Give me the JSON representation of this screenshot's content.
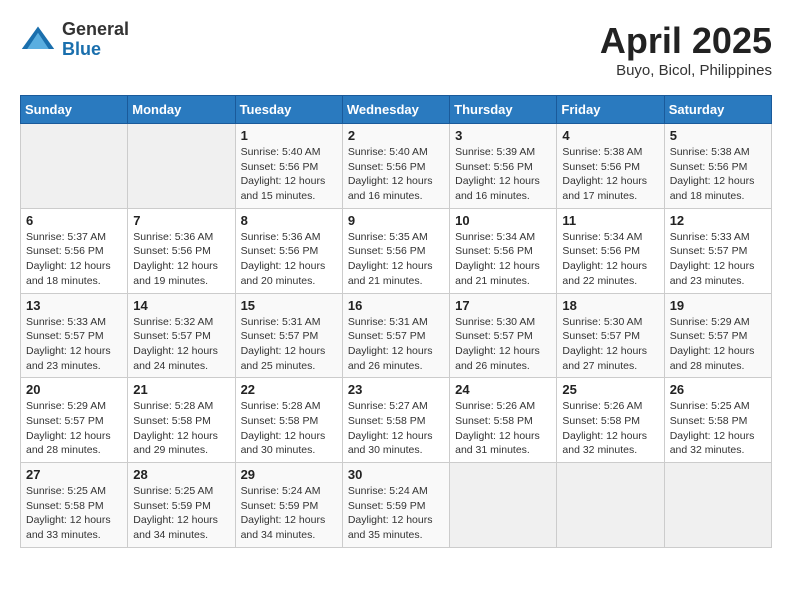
{
  "header": {
    "logo_general": "General",
    "logo_blue": "Blue",
    "title": "April 2025",
    "location": "Buyo, Bicol, Philippines"
  },
  "weekdays": [
    "Sunday",
    "Monday",
    "Tuesday",
    "Wednesday",
    "Thursday",
    "Friday",
    "Saturday"
  ],
  "weeks": [
    [
      {
        "day": "",
        "detail": ""
      },
      {
        "day": "",
        "detail": ""
      },
      {
        "day": "1",
        "detail": "Sunrise: 5:40 AM\nSunset: 5:56 PM\nDaylight: 12 hours and 15 minutes."
      },
      {
        "day": "2",
        "detail": "Sunrise: 5:40 AM\nSunset: 5:56 PM\nDaylight: 12 hours and 16 minutes."
      },
      {
        "day": "3",
        "detail": "Sunrise: 5:39 AM\nSunset: 5:56 PM\nDaylight: 12 hours and 16 minutes."
      },
      {
        "day": "4",
        "detail": "Sunrise: 5:38 AM\nSunset: 5:56 PM\nDaylight: 12 hours and 17 minutes."
      },
      {
        "day": "5",
        "detail": "Sunrise: 5:38 AM\nSunset: 5:56 PM\nDaylight: 12 hours and 18 minutes."
      }
    ],
    [
      {
        "day": "6",
        "detail": "Sunrise: 5:37 AM\nSunset: 5:56 PM\nDaylight: 12 hours and 18 minutes."
      },
      {
        "day": "7",
        "detail": "Sunrise: 5:36 AM\nSunset: 5:56 PM\nDaylight: 12 hours and 19 minutes."
      },
      {
        "day": "8",
        "detail": "Sunrise: 5:36 AM\nSunset: 5:56 PM\nDaylight: 12 hours and 20 minutes."
      },
      {
        "day": "9",
        "detail": "Sunrise: 5:35 AM\nSunset: 5:56 PM\nDaylight: 12 hours and 21 minutes."
      },
      {
        "day": "10",
        "detail": "Sunrise: 5:34 AM\nSunset: 5:56 PM\nDaylight: 12 hours and 21 minutes."
      },
      {
        "day": "11",
        "detail": "Sunrise: 5:34 AM\nSunset: 5:56 PM\nDaylight: 12 hours and 22 minutes."
      },
      {
        "day": "12",
        "detail": "Sunrise: 5:33 AM\nSunset: 5:57 PM\nDaylight: 12 hours and 23 minutes."
      }
    ],
    [
      {
        "day": "13",
        "detail": "Sunrise: 5:33 AM\nSunset: 5:57 PM\nDaylight: 12 hours and 23 minutes."
      },
      {
        "day": "14",
        "detail": "Sunrise: 5:32 AM\nSunset: 5:57 PM\nDaylight: 12 hours and 24 minutes."
      },
      {
        "day": "15",
        "detail": "Sunrise: 5:31 AM\nSunset: 5:57 PM\nDaylight: 12 hours and 25 minutes."
      },
      {
        "day": "16",
        "detail": "Sunrise: 5:31 AM\nSunset: 5:57 PM\nDaylight: 12 hours and 26 minutes."
      },
      {
        "day": "17",
        "detail": "Sunrise: 5:30 AM\nSunset: 5:57 PM\nDaylight: 12 hours and 26 minutes."
      },
      {
        "day": "18",
        "detail": "Sunrise: 5:30 AM\nSunset: 5:57 PM\nDaylight: 12 hours and 27 minutes."
      },
      {
        "day": "19",
        "detail": "Sunrise: 5:29 AM\nSunset: 5:57 PM\nDaylight: 12 hours and 28 minutes."
      }
    ],
    [
      {
        "day": "20",
        "detail": "Sunrise: 5:29 AM\nSunset: 5:57 PM\nDaylight: 12 hours and 28 minutes."
      },
      {
        "day": "21",
        "detail": "Sunrise: 5:28 AM\nSunset: 5:58 PM\nDaylight: 12 hours and 29 minutes."
      },
      {
        "day": "22",
        "detail": "Sunrise: 5:28 AM\nSunset: 5:58 PM\nDaylight: 12 hours and 30 minutes."
      },
      {
        "day": "23",
        "detail": "Sunrise: 5:27 AM\nSunset: 5:58 PM\nDaylight: 12 hours and 30 minutes."
      },
      {
        "day": "24",
        "detail": "Sunrise: 5:26 AM\nSunset: 5:58 PM\nDaylight: 12 hours and 31 minutes."
      },
      {
        "day": "25",
        "detail": "Sunrise: 5:26 AM\nSunset: 5:58 PM\nDaylight: 12 hours and 32 minutes."
      },
      {
        "day": "26",
        "detail": "Sunrise: 5:25 AM\nSunset: 5:58 PM\nDaylight: 12 hours and 32 minutes."
      }
    ],
    [
      {
        "day": "27",
        "detail": "Sunrise: 5:25 AM\nSunset: 5:58 PM\nDaylight: 12 hours and 33 minutes."
      },
      {
        "day": "28",
        "detail": "Sunrise: 5:25 AM\nSunset: 5:59 PM\nDaylight: 12 hours and 34 minutes."
      },
      {
        "day": "29",
        "detail": "Sunrise: 5:24 AM\nSunset: 5:59 PM\nDaylight: 12 hours and 34 minutes."
      },
      {
        "day": "30",
        "detail": "Sunrise: 5:24 AM\nSunset: 5:59 PM\nDaylight: 12 hours and 35 minutes."
      },
      {
        "day": "",
        "detail": ""
      },
      {
        "day": "",
        "detail": ""
      },
      {
        "day": "",
        "detail": ""
      }
    ]
  ]
}
